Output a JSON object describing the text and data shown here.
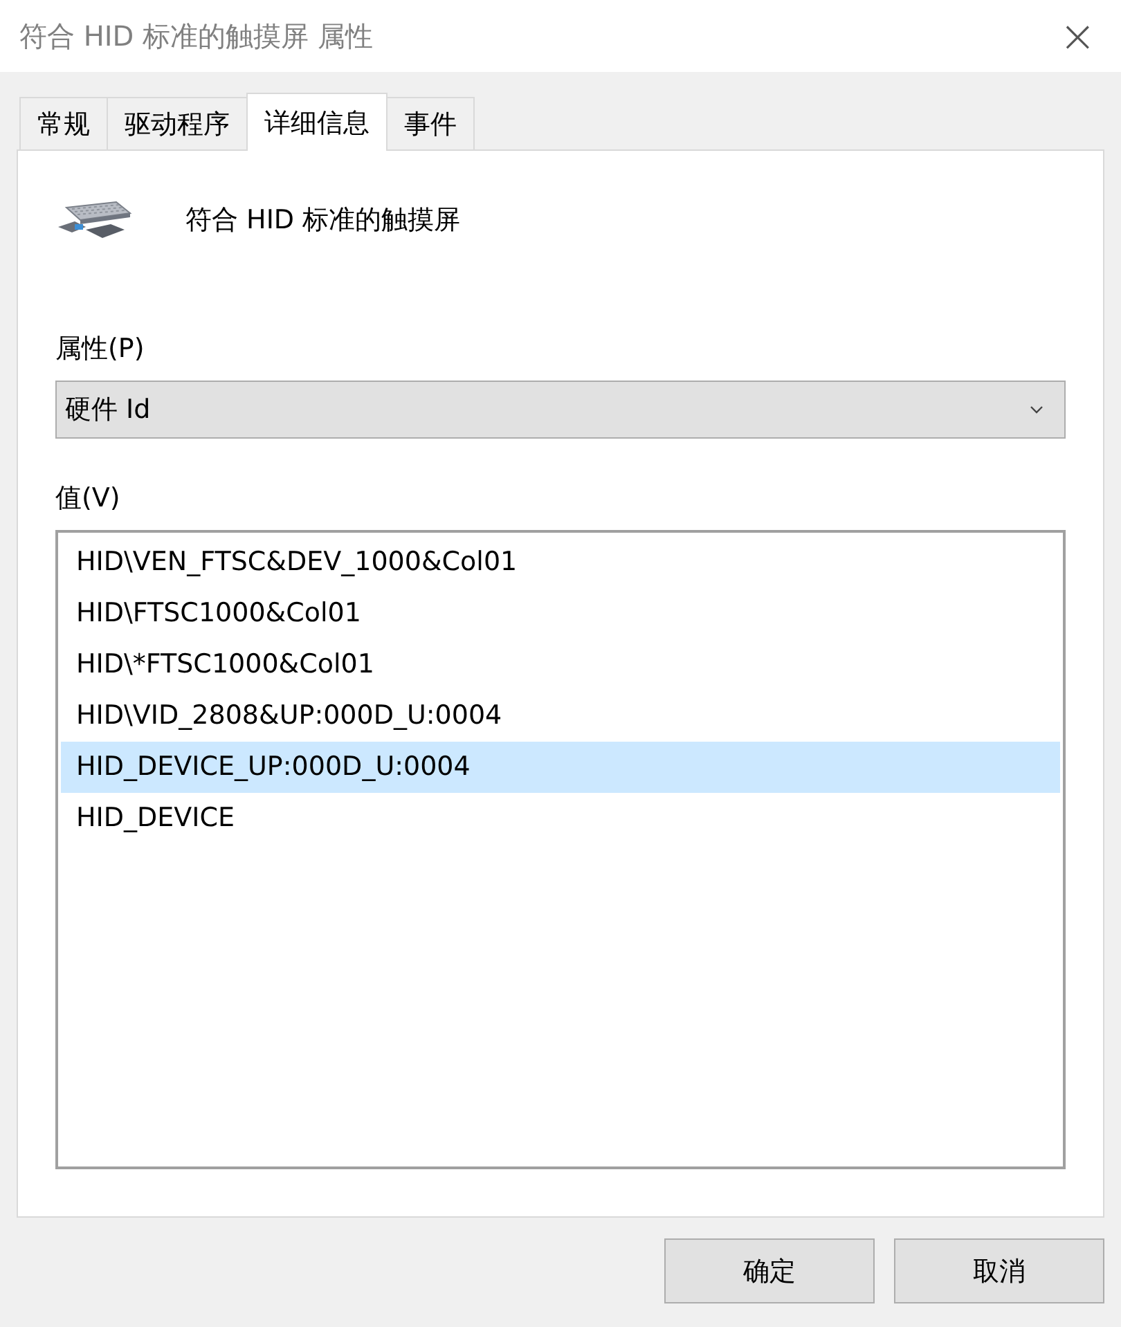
{
  "window": {
    "title": "符合 HID 标准的触摸屏 属性",
    "close": "×"
  },
  "tabs": [
    {
      "label": "常规",
      "selected": false
    },
    {
      "label": "驱动程序",
      "selected": false
    },
    {
      "label": "详细信息",
      "selected": true
    },
    {
      "label": "事件",
      "selected": false
    }
  ],
  "device": {
    "name": "符合 HID 标准的触摸屏"
  },
  "property": {
    "label": "属性(P)",
    "value": "硬件 Id"
  },
  "values": {
    "label": "值(V)",
    "items": [
      {
        "text": "HID\\VEN_FTSC&DEV_1000&Col01",
        "selected": false
      },
      {
        "text": "HID\\FTSC1000&Col01",
        "selected": false
      },
      {
        "text": "HID\\*FTSC1000&Col01",
        "selected": false
      },
      {
        "text": "HID\\VID_2808&UP:000D_U:0004",
        "selected": false
      },
      {
        "text": "HID_DEVICE_UP:000D_U:0004",
        "selected": true
      },
      {
        "text": "HID_DEVICE",
        "selected": false
      }
    ]
  },
  "buttons": [
    "确定",
    "取消"
  ]
}
